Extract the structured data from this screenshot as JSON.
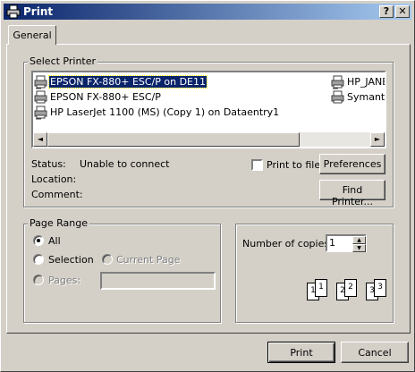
{
  "window": {
    "title": "Print",
    "help_glyph": "?",
    "close_glyph": "✕"
  },
  "tabs": [
    {
      "label": "General"
    }
  ],
  "select_printer": {
    "label": "Select Printer",
    "printers": [
      {
        "name": "EPSON FX-880+ ESC/P on DE11",
        "selected": true
      },
      {
        "name": "EPSON FX-880+ ESC/P",
        "selected": false
      },
      {
        "name": "HP LaserJet 1100 (MS) (Copy 1) on Dataentry1",
        "selected": false
      },
      {
        "name": "HP_JANE",
        "selected": false
      },
      {
        "name": "Symante",
        "selected": false
      }
    ],
    "scroll_left": "◄",
    "scroll_right": "►"
  },
  "status": {
    "status_label": "Status:",
    "status_value": "Unable to connect",
    "location_label": "Location:",
    "location_value": "",
    "comment_label": "Comment:",
    "comment_value": ""
  },
  "print_to_file": {
    "label": "Print to file",
    "checked": false
  },
  "buttons": {
    "preferences": "Preferences",
    "find_printer": "Find Printer...",
    "print": "Print",
    "cancel": "Cancel"
  },
  "page_range": {
    "label": "Page Range",
    "all": "All",
    "selection": "Selection",
    "current_page": "Current Page",
    "pages": "Pages:",
    "pages_value": ""
  },
  "copies": {
    "label": "Number of copies:",
    "value": "1",
    "spin_up": "▲",
    "spin_down": "▼",
    "collate_pages": [
      "1",
      "1",
      "2",
      "2",
      "3",
      "3"
    ]
  }
}
